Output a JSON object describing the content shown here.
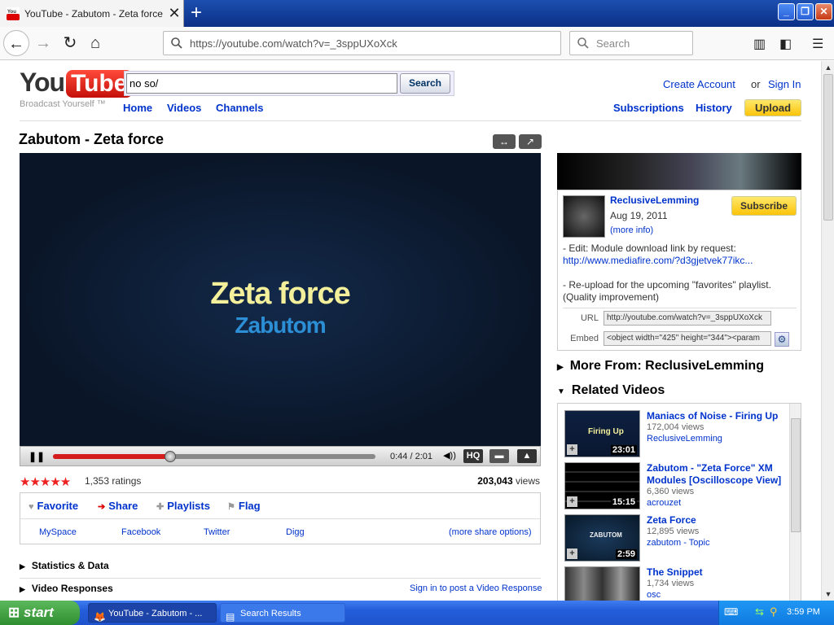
{
  "browser": {
    "tab_title": "YouTube - Zabutom - Zeta force",
    "url": "https://youtube.com/watch?v=_3sppUXoXck",
    "search_placeholder": "Search"
  },
  "header": {
    "logo_you": "You",
    "logo_tube": "Tube",
    "tagline": "Broadcast Yourself ™",
    "search_value": "no so/",
    "search_button": "Search",
    "nav": [
      "Home",
      "Videos",
      "Channels"
    ],
    "create_account": "Create Account",
    "or": "or",
    "sign_in": "Sign In",
    "subscriptions": "Subscriptions",
    "history": "History",
    "upload": "Upload"
  },
  "video": {
    "title": "Zabutom - Zeta force",
    "overlay_line1": "Zeta force",
    "overlay_line2": "Zabutom",
    "time": "0:44 / 2:01",
    "progress": 0.364,
    "hq": "HQ",
    "stars": "★★★★★",
    "ratings": "1,353 ratings",
    "views_count": "203,043",
    "views_label": "views"
  },
  "actions": {
    "favorite": "Favorite",
    "share": "Share",
    "playlists": "Playlists",
    "flag": "Flag",
    "share_sites": [
      "MySpace",
      "Facebook",
      "Twitter",
      "Digg"
    ],
    "more_share": "(more share options)"
  },
  "sections": {
    "stats": "Statistics & Data",
    "responses": "Video Responses",
    "post_response": "Sign in to post a Video Response"
  },
  "channel": {
    "name": "ReclusiveLemming",
    "date": "Aug 19, 2011",
    "more_info": "(more info)",
    "subscribe": "Subscribe",
    "desc1": "- Edit: Module download link by request:",
    "desc_link": "http://www.mediafire.com/?d3gjetvek77ikc...",
    "desc2": "- Re-upload for the upcoming \"favorites\" playlist.",
    "desc3": "(Quality improvement)",
    "url_label": "URL",
    "url_value": "http://youtube.com/watch?v=_3sppUXoXck",
    "embed_label": "Embed",
    "embed_value": "<object width=\"425\" height=\"344\"><param"
  },
  "right": {
    "more_from": "More From: ReclusiveLemming",
    "related_heading": "Related Videos"
  },
  "related": [
    {
      "title": "Maniacs of Noise - Firing Up",
      "views": "172,004 views",
      "channel": "ReclusiveLemming",
      "duration": "23:01",
      "thumb_text": "Firing Up"
    },
    {
      "title": "Zabutom - \"Zeta Force\" XM Modules [Oscilloscope View]",
      "views": "6,360 views",
      "channel": "acrouzet",
      "duration": "15:15",
      "thumb_text": ""
    },
    {
      "title": "Zeta Force",
      "views": "12,895 views",
      "channel": "zabutom - Topic",
      "duration": "2:59",
      "thumb_text": "ZABUTOM"
    },
    {
      "title": "The Snippet",
      "views": "1,734 views",
      "channel": "osc",
      "duration": "",
      "thumb_text": ""
    }
  ],
  "taskbar": {
    "start": "start",
    "task1": "YouTube - Zabutom - ...",
    "task2": "Search Results",
    "clock": "3:59 PM"
  }
}
